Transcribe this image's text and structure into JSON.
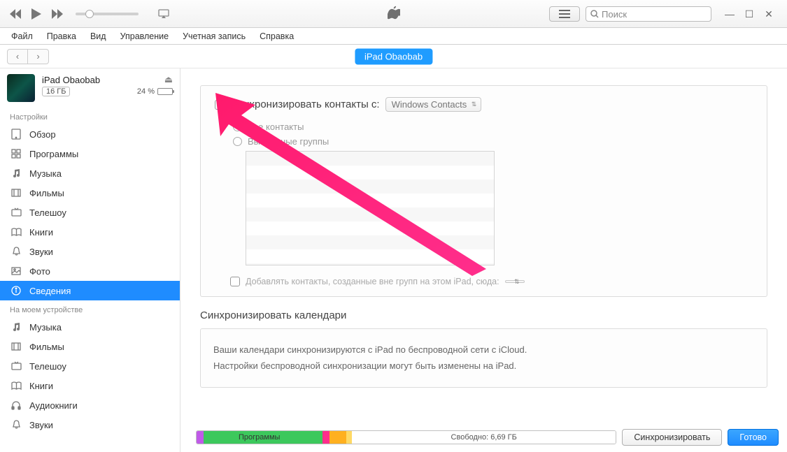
{
  "search_placeholder": "Поиск",
  "menubar": {
    "file": "Файл",
    "edit": "Правка",
    "view": "Вид",
    "control": "Управление",
    "account": "Учетная запись",
    "help": "Справка"
  },
  "device_pill": "iPad Obaobab",
  "sidebar": {
    "device": {
      "name": "iPad Obaobab",
      "capacity": "16 ГБ",
      "battery_pct": "24 %"
    },
    "section_settings": "Настройки",
    "settings_items": [
      "Обзор",
      "Программы",
      "Музыка",
      "Фильмы",
      "Телешоу",
      "Книги",
      "Звуки",
      "Фото",
      "Сведения"
    ],
    "section_ondevice": "На моем устройстве",
    "ondevice_items": [
      "Музыка",
      "Фильмы",
      "Телешоу",
      "Книги",
      "Аудиокниги",
      "Звуки"
    ]
  },
  "content": {
    "sync_contacts_label": "Синхронизировать контакты с:",
    "sync_contacts_select": "Windows Contacts",
    "radio_all": "Все контакты",
    "radio_selected": "Выбранные группы",
    "add_outside_label": "Добавлять контакты, созданные вне групп на этом iPad, сюда:",
    "sync_calendars_title": "Синхронизировать календари",
    "cal_line1": "Ваши календари синхронизируются с iPad по беспроводной сети с iCloud.",
    "cal_line2": "Настройки беспроводной синхронизации могут быть изменены на iPad."
  },
  "bottom": {
    "apps_label": "Программы",
    "free_label": "Свободно: 6,69 ГБ",
    "sync_btn": "Синхронизировать",
    "done_btn": "Готово"
  },
  "colors": {
    "audio": "#c05ae8",
    "apps": "#3cc85c",
    "docs": "#ffb020",
    "other": "#ffd965"
  }
}
